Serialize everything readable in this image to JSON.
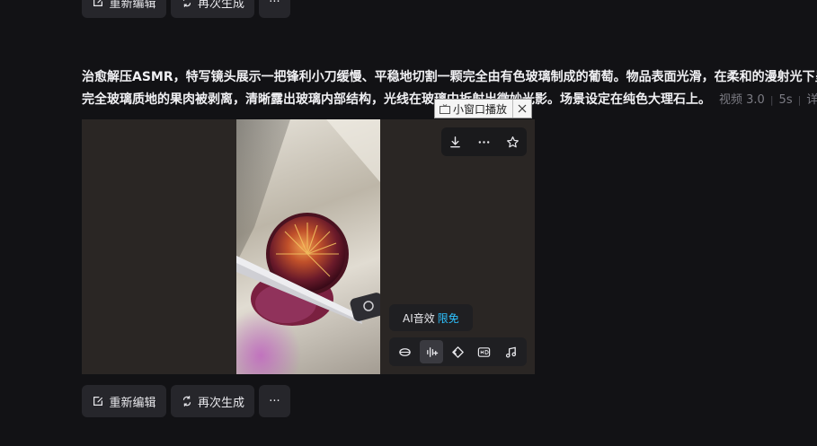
{
  "top_actions": {
    "edit_label": "重新编辑",
    "regen_label": "再次生成",
    "more_label": "···"
  },
  "prompt": {
    "line1": "治愈解压ASMR，特写镜头展示一把锋利小刀缓慢、平稳地切割一颗完全由有色玻璃制成的葡萄。物品表面光滑，在柔和的漫射光下呈",
    "line2": "完全玻璃质地的果肉被剥离，清晰露出玻璃内部结构，光线在玻璃中折射出微妙光影。场景设定在纯色大理石上。",
    "model": "视频 3.0",
    "duration": "5s",
    "details": "详"
  },
  "video_card": {
    "toolbar_top": {
      "download_icon": "download-icon",
      "more_icon": "more-icon",
      "favorite_icon": "star-icon"
    },
    "ai_sound": {
      "label": "AI音效",
      "badge": "限免"
    },
    "toolbar_bottom": [
      "lip-sync-icon",
      "audio-wave-icon",
      "diamond-icon",
      "hd-icon",
      "music-note-icon"
    ]
  },
  "pip_tooltip": {
    "label": "小窗口播放"
  },
  "bottom_actions": {
    "edit_label": "重新编辑",
    "regen_label": "再次生成",
    "more_label": "···"
  },
  "colors": {
    "background": "#121215",
    "button": "#26262b",
    "accent": "#2ec2ff"
  }
}
